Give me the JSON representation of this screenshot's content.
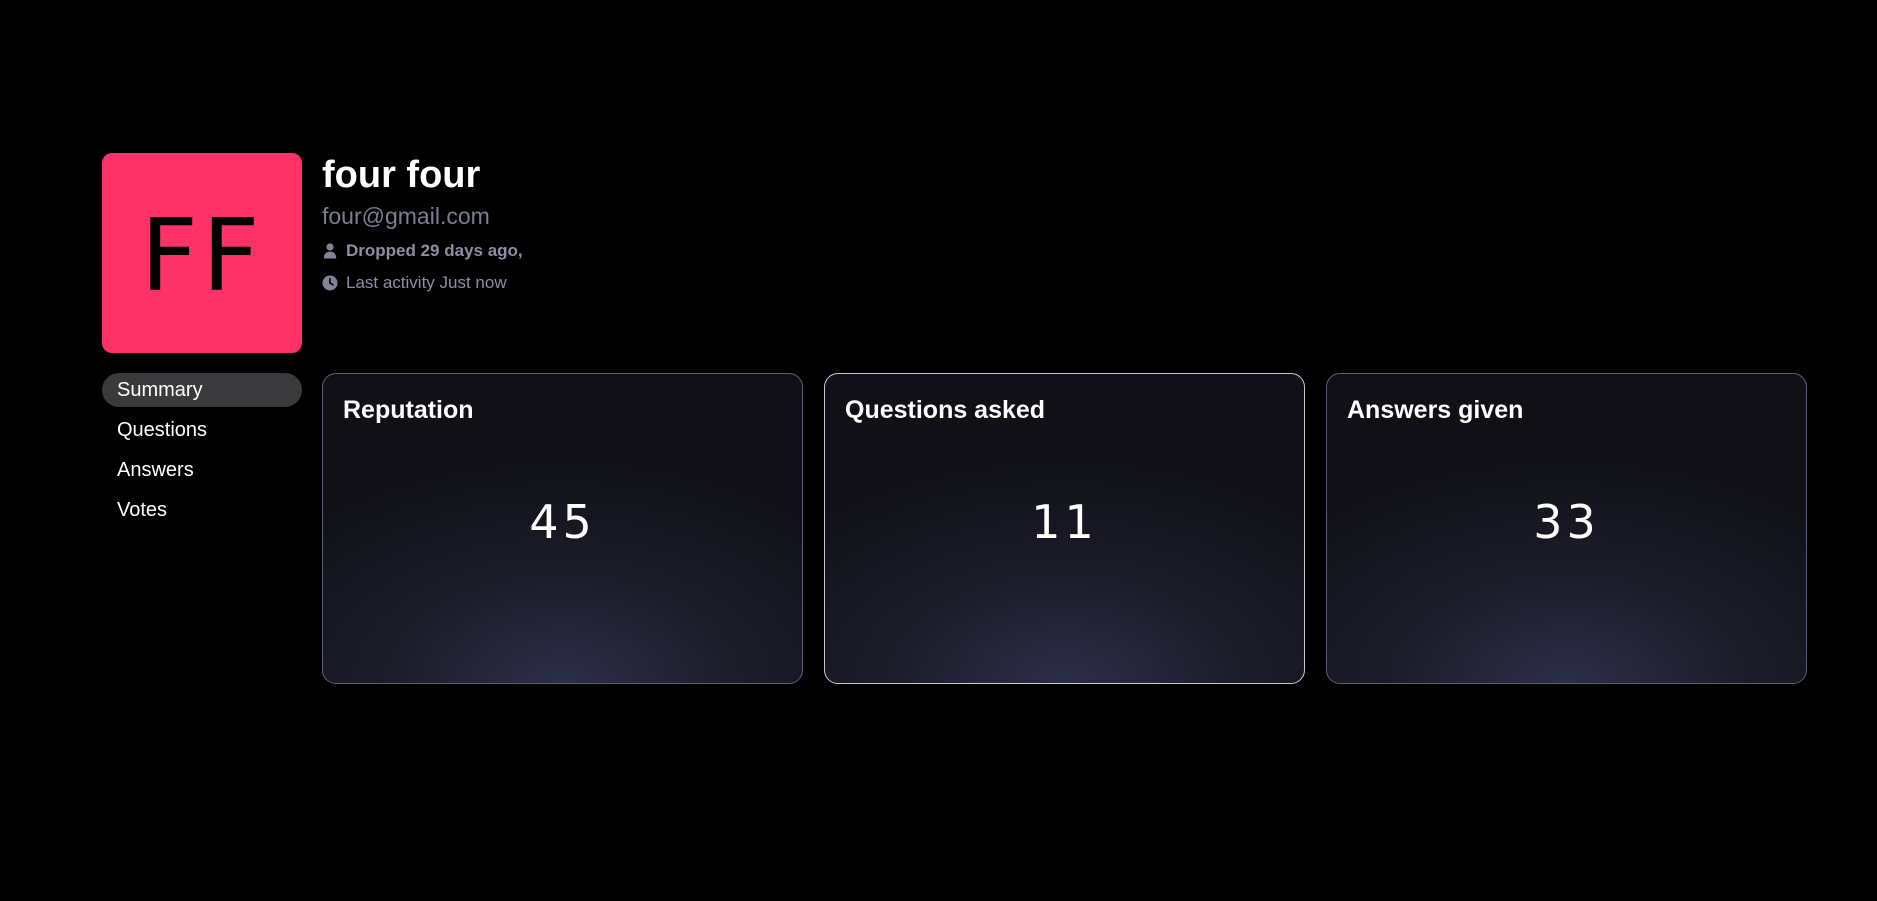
{
  "profile": {
    "initials": "FF",
    "avatar_color": "#ff3268",
    "name": "four four",
    "email": "four@gmail.com",
    "joined_text": "Dropped 29 days ago,",
    "joined_icon": "user-icon",
    "last_activity_text": "Last activity Just now",
    "last_activity_icon": "clock-icon"
  },
  "sidebar": {
    "items": [
      {
        "label": "Summary",
        "active": true
      },
      {
        "label": "Questions",
        "active": false
      },
      {
        "label": "Answers",
        "active": false
      },
      {
        "label": "Votes",
        "active": false
      }
    ]
  },
  "stats": [
    {
      "title": "Reputation",
      "value": "45"
    },
    {
      "title": "Questions asked",
      "value": "11"
    },
    {
      "title": "Answers given",
      "value": "33"
    }
  ],
  "colors": {
    "background": "#000000",
    "muted_text": "#7a7f93",
    "active_nav": "#3a3a3c"
  }
}
